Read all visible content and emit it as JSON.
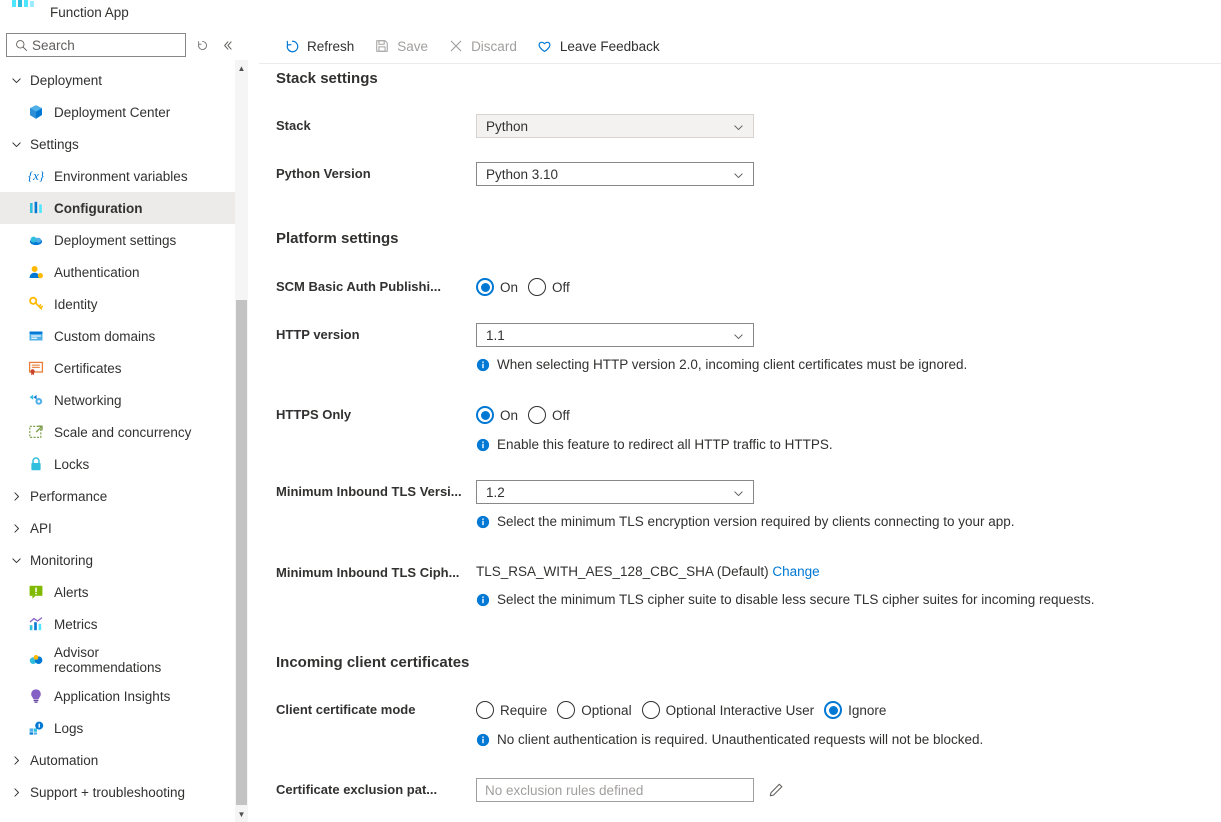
{
  "resource": {
    "icon": "function-app-icon",
    "title": "Function App"
  },
  "search": {
    "placeholder": "Search",
    "value": "",
    "icon": "search-icon",
    "refresh_icon": "refresh-nav-icon",
    "collapse_icon": "collapse-nav-icon"
  },
  "sidebar": {
    "groups": [
      {
        "label": "Deployment",
        "expanded": true,
        "chevron": "chevron-down-icon",
        "items": [
          {
            "label": "Deployment Center",
            "icon": "deployment-center-icon",
            "selected": false
          }
        ]
      },
      {
        "label": "Settings",
        "expanded": true,
        "chevron": "chevron-down-icon",
        "items": [
          {
            "label": "Environment variables",
            "icon": "environment-variables-icon",
            "selected": false
          },
          {
            "label": "Configuration",
            "icon": "configuration-icon",
            "selected": true
          },
          {
            "label": "Deployment settings",
            "icon": "deployment-settings-icon",
            "selected": false
          },
          {
            "label": "Authentication",
            "icon": "authentication-icon",
            "selected": false
          },
          {
            "label": "Identity",
            "icon": "identity-icon",
            "selected": false
          },
          {
            "label": "Custom domains",
            "icon": "custom-domains-icon",
            "selected": false
          },
          {
            "label": "Certificates",
            "icon": "certificates-icon",
            "selected": false
          },
          {
            "label": "Networking",
            "icon": "networking-icon",
            "selected": false
          },
          {
            "label": "Scale and concurrency",
            "icon": "scale-and-concurrency-icon",
            "selected": false
          },
          {
            "label": "Locks",
            "icon": "locks-icon",
            "selected": false
          }
        ]
      },
      {
        "label": "Performance",
        "expanded": false,
        "chevron": "chevron-right-icon",
        "items": []
      },
      {
        "label": "API",
        "expanded": false,
        "chevron": "chevron-right-icon",
        "items": []
      },
      {
        "label": "Monitoring",
        "expanded": true,
        "chevron": "chevron-down-icon",
        "items": [
          {
            "label": "Alerts",
            "icon": "alerts-icon",
            "selected": false
          },
          {
            "label": "Metrics",
            "icon": "metrics-icon",
            "selected": false
          },
          {
            "label": "Advisor recommendations",
            "icon": "advisor-recommendations-icon",
            "selected": false,
            "two_line": true
          },
          {
            "label": "Application Insights",
            "icon": "application-insights-icon",
            "selected": false
          },
          {
            "label": "Logs",
            "icon": "logs-icon",
            "selected": false
          }
        ]
      },
      {
        "label": "Automation",
        "expanded": false,
        "chevron": "chevron-right-icon",
        "items": []
      },
      {
        "label": "Support + troubleshooting",
        "expanded": false,
        "chevron": "chevron-right-icon",
        "items": []
      }
    ]
  },
  "toolbar": {
    "refresh_label": "Refresh",
    "save_label": "Save",
    "discard_label": "Discard",
    "feedback_label": "Leave Feedback"
  },
  "content": {
    "stack_settings": {
      "heading": "Stack settings",
      "stack_label": "Stack",
      "stack_value": "Python",
      "python_version_label": "Python Version",
      "python_version_value": "Python 3.10"
    },
    "platform_settings": {
      "heading": "Platform settings",
      "scm_label": "SCM Basic Auth Publishi...",
      "scm_on": "On",
      "scm_off": "Off",
      "scm_selected": "On",
      "http_version_label": "HTTP version",
      "http_version_value": "1.1",
      "http_version_hint": "When selecting HTTP version 2.0, incoming client certificates must be ignored.",
      "https_only_label": "HTTPS Only",
      "https_on": "On",
      "https_off": "Off",
      "https_selected": "On",
      "https_only_hint": "Enable this feature to redirect all HTTP traffic to HTTPS.",
      "tls_version_label": "Minimum Inbound TLS Versi...",
      "tls_version_value": "1.2",
      "tls_version_hint": "Select the minimum TLS encryption version required by clients connecting to your app.",
      "tls_cipher_label": "Minimum Inbound TLS Ciph...",
      "tls_cipher_value": "TLS_RSA_WITH_AES_128_CBC_SHA (Default)",
      "tls_cipher_change": "Change",
      "tls_cipher_hint": "Select the minimum TLS cipher suite to disable less secure TLS cipher suites for incoming requests."
    },
    "incoming_client_certificates": {
      "heading": "Incoming client certificates",
      "mode_label": "Client certificate mode",
      "mode_options": [
        "Require",
        "Optional",
        "Optional Interactive User",
        "Ignore"
      ],
      "mode_selected": "Ignore",
      "mode_hint": "No client authentication is required. Unauthenticated requests will not be blocked.",
      "exclusion_label": "Certificate exclusion pat...",
      "exclusion_placeholder": "No exclusion rules defined",
      "exclusion_value": "",
      "edit_icon": "pencil-icon"
    }
  },
  "colors": {
    "accent": "#0078d4",
    "selected_row": "#edebe9",
    "disabled_text": "#a19f9d"
  }
}
